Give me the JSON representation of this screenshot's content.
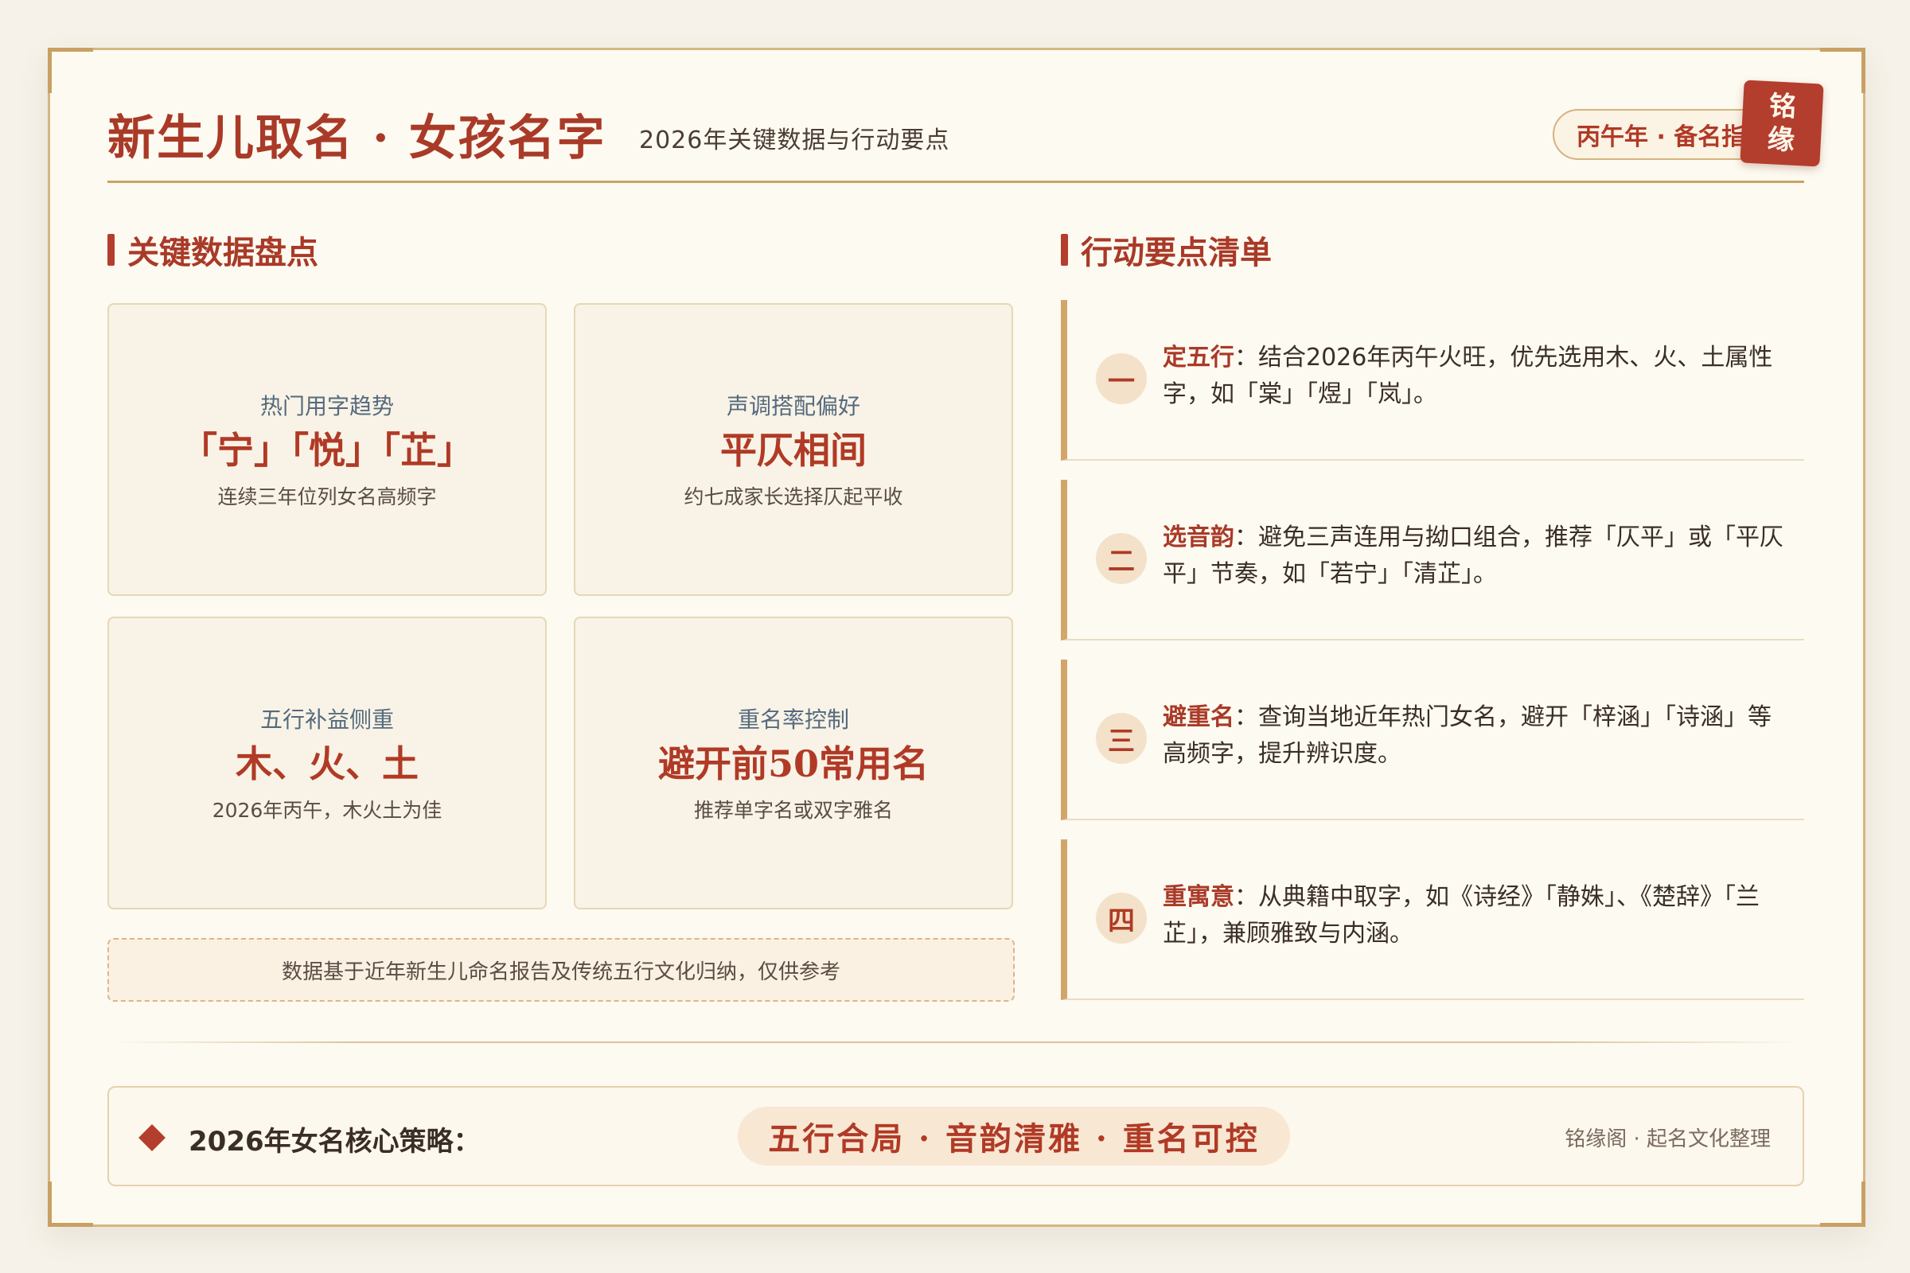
{
  "header": {
    "title": "新生儿取名 · 女孩名字",
    "subtitle": "2026年关键数据与行动要点",
    "year_tag": "丙午年 · 备名指南",
    "seal_chars": [
      "铭",
      "缘"
    ]
  },
  "key_data": {
    "heading": "关键数据盘点",
    "cards": [
      {
        "label": "热门用字趋势",
        "value": "「宁」「悦」「芷」",
        "note": "连续三年位列女名高频字"
      },
      {
        "label": "声调搭配偏好",
        "value": "平仄相间",
        "note": "约七成家长选择仄起平收"
      },
      {
        "label": "五行补益侧重",
        "value": "木、火、土",
        "note": "2026年丙午，木火土为佳"
      },
      {
        "label": "重名率控制",
        "value": "避开前50常用名",
        "note": "推荐单字名或双字雅名"
      }
    ],
    "footnote": "数据基于近年新生儿命名报告及传统五行文化归纳，仅供参考"
  },
  "actions": {
    "heading": "行动要点清单",
    "items": [
      {
        "number": "一",
        "key": "定五行",
        "separator": "：",
        "text": "结合2026年丙午火旺，优先选用木、火、土属性字，如「棠」「煜」「岚」。"
      },
      {
        "number": "二",
        "key": "选音韵",
        "separator": "：",
        "text": "避免三声连用与拗口组合，推荐「仄平」或「平仄平」节奏，如「若宁」「清芷」。"
      },
      {
        "number": "三",
        "key": "避重名",
        "separator": "：",
        "text": "查询当地近年热门女名，避开「梓涵」「诗涵」等高频字，提升辨识度。"
      },
      {
        "number": "四",
        "key": "重寓意",
        "separator": "：",
        "text": "从典籍中取字，如《诗经》「静姝」、《楚辞》「兰芷」，兼顾雅致与内涵。"
      }
    ]
  },
  "strategy": {
    "label": "2026年女名核心策略：",
    "core": "五行合局 · 音韵清雅 · 重名可控",
    "credit": "铭缘阁 · 起名文化整理"
  },
  "colors": {
    "accent": "#b03a26",
    "gold_border": "#c9a366",
    "paper": "#fdfaf1",
    "background": "#f6f2e9"
  }
}
